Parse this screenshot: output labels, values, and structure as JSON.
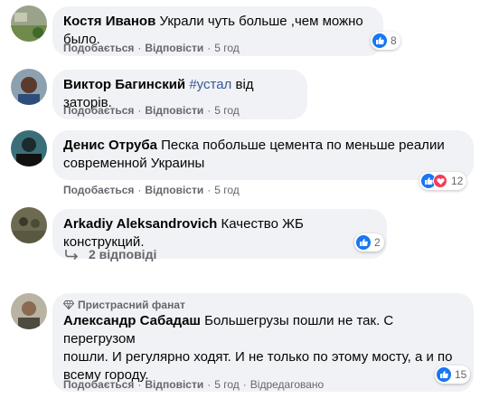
{
  "comments": [
    {
      "author": "Костя Иванов",
      "text": "Украли чуть больше ,чем можно было.",
      "actions": {
        "like": "Подобається",
        "reply": "Відповісти",
        "time": "5 год"
      },
      "reactions": {
        "count": "8",
        "types": [
          "like"
        ]
      }
    },
    {
      "author": "Виктор Багинский",
      "hashtag": "#устал",
      "text": " від заторів.",
      "actions": {
        "like": "Подобається",
        "reply": "Відповісти",
        "time": "5 год"
      }
    },
    {
      "author": "Денис Отруба",
      "text_line1": "Песка побольше цемента по меньше реалии",
      "text_line2": "современной Украины",
      "actions": {
        "like": "Подобається",
        "reply": "Відповісти",
        "time": "5 год"
      },
      "reactions": {
        "count": "12",
        "types": [
          "like",
          "love"
        ]
      }
    },
    {
      "author": "Arkadiy Aleksandrovich",
      "text": "Качество ЖБ конструкций.",
      "actions": {
        "like": "Подобається",
        "reply": "Відповісти",
        "time": "5 год"
      },
      "reactions": {
        "count": "2",
        "types": [
          "like"
        ]
      },
      "replies_link": "2 відповіді"
    },
    {
      "badge": "Пристрасний фанат",
      "author": "Александр Сабадаш",
      "text_line1": "Большегрузы пошли не так. С перегрузом",
      "text_line2": "пошли. И регулярно ходят. И не только по этому мосту, а и по",
      "text_line3": "всему городу.",
      "actions": {
        "like": "Подобається",
        "reply": "Відповісти",
        "time": "5 год",
        "edited": "Відредаговано"
      },
      "reactions": {
        "count": "15",
        "types": [
          "like"
        ]
      }
    }
  ],
  "colors": {
    "bubble": "#f0f2f5",
    "link": "#385898",
    "like": "#1877f2",
    "love": "#f33e58",
    "meta": "#65676b"
  }
}
